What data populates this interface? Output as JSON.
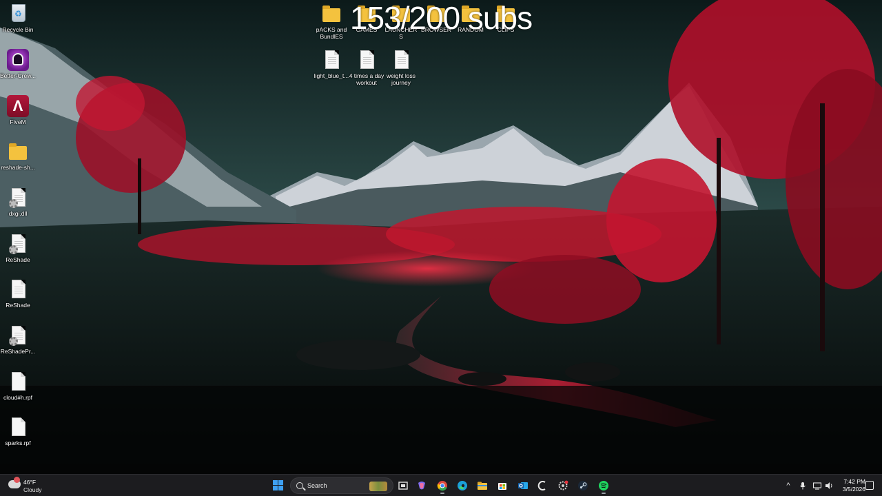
{
  "overlay": {
    "counter_text": "153/200 subs"
  },
  "desktop": {
    "left_column": [
      {
        "label": "Recycle Bin",
        "icon": "recycle-bin-icon"
      },
      {
        "label": "Better-Crew...",
        "icon": "better-crewlink-app-icon"
      },
      {
        "label": "FiveM",
        "icon": "fivem-app-icon"
      },
      {
        "label": "reshade-sh...",
        "icon": "folder-icon"
      },
      {
        "label": "dxgi.dll",
        "icon": "settings-file-icon"
      },
      {
        "label": "ReShade",
        "icon": "settings-file-icon"
      },
      {
        "label": "ReShade",
        "icon": "text-file-icon"
      },
      {
        "label": "ReShadePr...",
        "icon": "settings-file-icon"
      },
      {
        "label": "cloud#h.rpf",
        "icon": "file-icon"
      },
      {
        "label": "sparks.rpf",
        "icon": "file-icon"
      }
    ],
    "top_folders": [
      {
        "label": "pACKS and BundlES",
        "icon": "folder-icon"
      },
      {
        "label": "GAMES",
        "icon": "folder-icon"
      },
      {
        "label": "LAUNCHERS",
        "icon": "folder-icon"
      },
      {
        "label": "BROWSER",
        "icon": "folder-icon"
      },
      {
        "label": "RANDOM",
        "icon": "folder-icon"
      },
      {
        "label": "CLIPS",
        "icon": "folder-icon"
      }
    ],
    "top_files": [
      {
        "label": "light_blue_t...",
        "icon": "text-file-icon"
      },
      {
        "label": "4 times a day workout",
        "icon": "text-file-icon"
      },
      {
        "label": "weight loss journey",
        "icon": "text-file-icon"
      }
    ]
  },
  "taskbar": {
    "weather": {
      "temperature": "46°F",
      "condition": "Cloudy"
    },
    "search": {
      "placeholder": "Search"
    },
    "clock": {
      "time": "7:42 PM",
      "date": "3/5/2026"
    },
    "colors": {
      "background": "#1c1c1f",
      "start_blue": "#3ea0f2",
      "spotify_green": "#1ed760"
    }
  }
}
